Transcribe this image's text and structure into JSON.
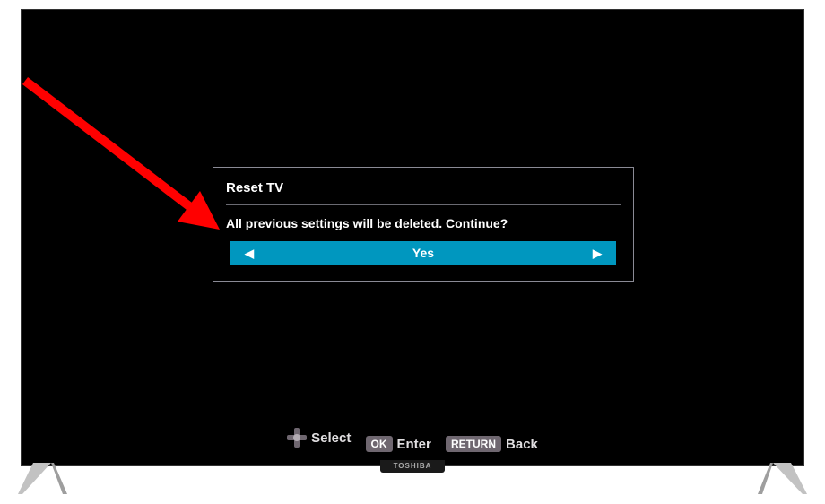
{
  "dialog": {
    "title": "Reset TV",
    "message": "All previous settings will be deleted. Continue?",
    "option_label": "Yes"
  },
  "hints": {
    "select_label": "Select",
    "enter_btn": "OK",
    "enter_label": "Enter",
    "back_btn": "RETURN",
    "back_label": "Back"
  },
  "brand": "TOSHIBA"
}
